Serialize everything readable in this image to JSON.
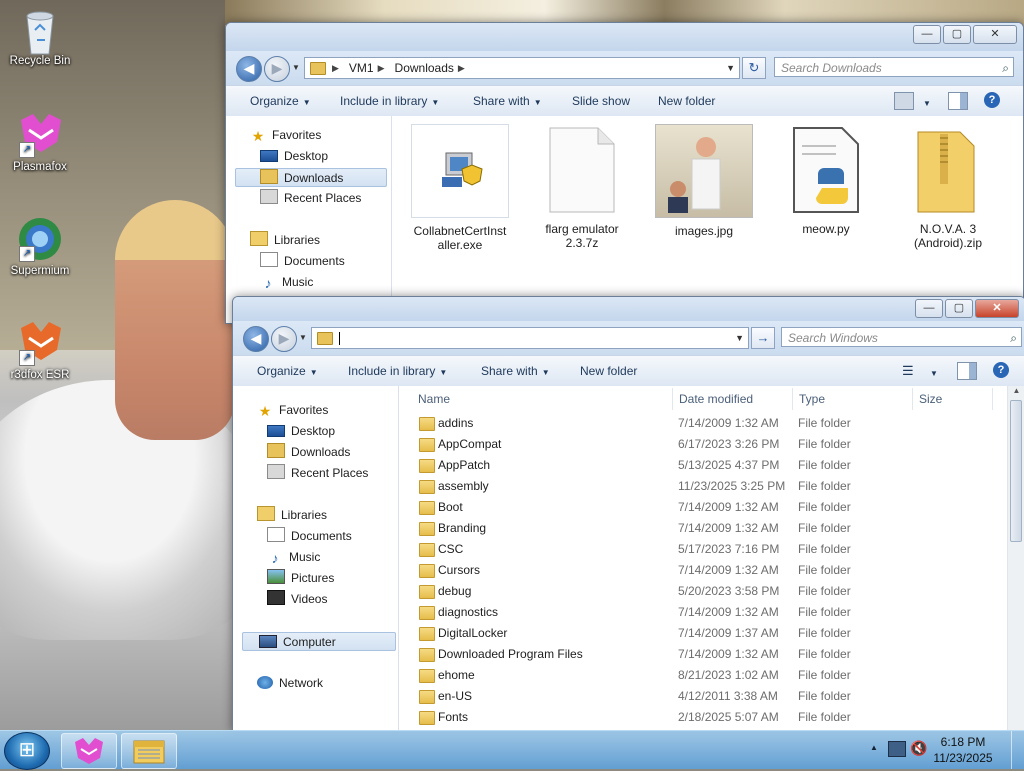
{
  "desktop_icons": [
    {
      "label": "Recycle Bin",
      "icon": "recycle-bin-icon"
    },
    {
      "label": "Plasmafox",
      "icon": "plasmafox-icon"
    },
    {
      "label": "Supermium",
      "icon": "supermium-icon"
    },
    {
      "label": "r3dfox ESR",
      "icon": "r3dfox-icon"
    }
  ],
  "window_downloads": {
    "breadcrumb": [
      "VM1",
      "Downloads"
    ],
    "search_placeholder": "Search Downloads",
    "commands": [
      "Organize",
      "Include in library",
      "Share with",
      "Slide show",
      "New folder"
    ],
    "nav": {
      "favorites_header": "Favorites",
      "favorites": [
        "Desktop",
        "Downloads",
        "Recent Places"
      ],
      "libraries_header": "Libraries",
      "libraries": [
        "Documents",
        "Music"
      ]
    },
    "files": [
      {
        "name": "CollabnetCertInst aller.exe",
        "icon": "installer-icon"
      },
      {
        "name": "flarg emulator 2.3.7z",
        "icon": "blank-file-icon"
      },
      {
        "name": "images.jpg",
        "icon": "image-thumbnail"
      },
      {
        "name": "meow.py",
        "icon": "python-file-icon"
      },
      {
        "name": "N.O.V.A. 3 (Android).zip",
        "icon": "zip-folder-icon"
      }
    ]
  },
  "window_windows": {
    "address_value": "",
    "search_placeholder": "Search Windows",
    "commands": [
      "Organize",
      "Include in library",
      "Share with",
      "New folder"
    ],
    "nav": {
      "favorites_header": "Favorites",
      "favorites": [
        "Desktop",
        "Downloads",
        "Recent Places"
      ],
      "libraries_header": "Libraries",
      "libraries": [
        "Documents",
        "Music",
        "Pictures",
        "Videos"
      ],
      "computer": "Computer",
      "network": "Network"
    },
    "columns": [
      "Name",
      "Date modified",
      "Type",
      "Size"
    ],
    "rows": [
      {
        "name": "addins",
        "date": "7/14/2009 1:32 AM",
        "type": "File folder"
      },
      {
        "name": "AppCompat",
        "date": "6/17/2023 3:26 PM",
        "type": "File folder"
      },
      {
        "name": "AppPatch",
        "date": "5/13/2025 4:37 PM",
        "type": "File folder"
      },
      {
        "name": "assembly",
        "date": "11/23/2025 3:25 PM",
        "type": "File folder"
      },
      {
        "name": "Boot",
        "date": "7/14/2009 1:32 AM",
        "type": "File folder"
      },
      {
        "name": "Branding",
        "date": "7/14/2009 1:32 AM",
        "type": "File folder"
      },
      {
        "name": "CSC",
        "date": "5/17/2023 7:16 PM",
        "type": "File folder"
      },
      {
        "name": "Cursors",
        "date": "7/14/2009 1:32 AM",
        "type": "File folder"
      },
      {
        "name": "debug",
        "date": "5/20/2023 3:58 PM",
        "type": "File folder"
      },
      {
        "name": "diagnostics",
        "date": "7/14/2009 1:32 AM",
        "type": "File folder"
      },
      {
        "name": "DigitalLocker",
        "date": "7/14/2009 1:37 AM",
        "type": "File folder"
      },
      {
        "name": "Downloaded Program Files",
        "date": "7/14/2009 1:32 AM",
        "type": "File folder"
      },
      {
        "name": "ehome",
        "date": "8/21/2023 1:02 AM",
        "type": "File folder"
      },
      {
        "name": "en-US",
        "date": "4/12/2011 3:38 AM",
        "type": "File folder"
      },
      {
        "name": "Fonts",
        "date": "2/18/2025 5:07 AM",
        "type": "File folder"
      }
    ]
  },
  "taskbar": {
    "time": "6:18 PM",
    "date": "11/23/2025",
    "buttons": [
      "plasmafox-taskbar-icon",
      "explorer-taskbar-icon"
    ]
  },
  "colors": {
    "accent": "#2b5fa5",
    "taskbar": "#60a0d7"
  }
}
